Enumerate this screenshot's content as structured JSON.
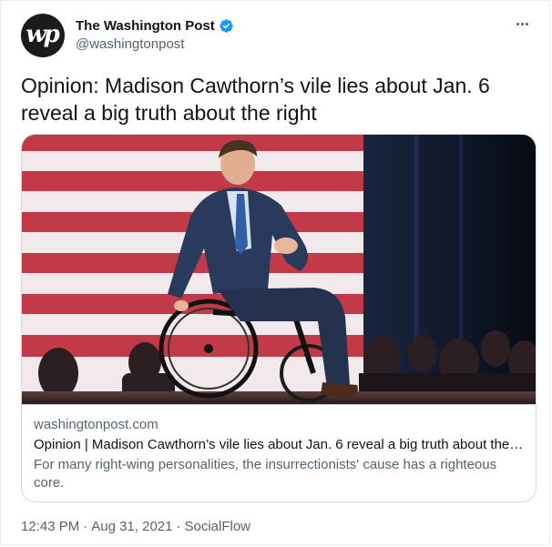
{
  "account": {
    "avatar_text": "wp",
    "display_name": "The Washington Post",
    "handle": "@washingtonpost",
    "verified": true
  },
  "tweet": {
    "text": "Opinion: Madison Cawthorn’s vile lies about Jan. 6 reveal a big truth about the right"
  },
  "card": {
    "domain": "washingtonpost.com",
    "title": "Opinion | Madison Cawthorn’s vile lies about Jan. 6 reveal a big truth about the …",
    "description": "For many right-wing personalities, the insurrectionists' cause has a righteous core."
  },
  "meta": {
    "time": "12:43 PM",
    "separator": "·",
    "date": "Aug 31, 2021",
    "source": "SocialFlow"
  },
  "colors": {
    "text_primary": "#0f1419",
    "text_secondary": "#536471",
    "verified_blue": "#1d9bf0",
    "border": "#cfd9de",
    "flag_red": "#c23a48",
    "flag_white": "#f4eef0"
  },
  "icons": {
    "verified": "verified-badge-icon",
    "more": "more-horizontal-icon"
  }
}
